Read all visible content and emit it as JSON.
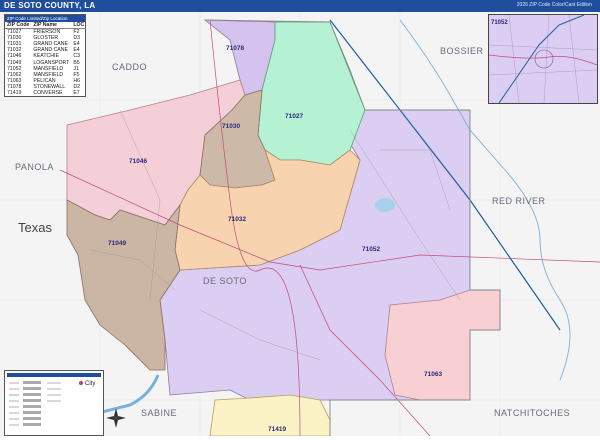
{
  "header": {
    "title": "DE SOTO COUNTY, LA",
    "edition": "2026 ZIP Code Color/Cast Edition"
  },
  "legend": {
    "header": "ZIP Code Limited/Zip Location",
    "columns": [
      "ZIP Code",
      "ZIP Name",
      "LOC"
    ],
    "rows": [
      [
        "71027",
        "FRIERSON",
        "F2"
      ],
      [
        "71030",
        "GLOSTER",
        "D3"
      ],
      [
        "71031",
        "GRAND CANE",
        "E4"
      ],
      [
        "71032",
        "GRAND CANE",
        "E4"
      ],
      [
        "71046",
        "KEATCHIE",
        "C3"
      ],
      [
        "71049",
        "LOGANSPORT",
        "B5"
      ],
      [
        "71052",
        "MANSFIELD",
        "J1"
      ],
      [
        "71062",
        "MANSFIELD",
        "F5"
      ],
      [
        "71063",
        "PELICAN",
        "H6"
      ],
      [
        "71078",
        "STONEWALL",
        "D2"
      ],
      [
        "71419",
        "CONVERSE",
        "E7"
      ]
    ]
  },
  "counties": {
    "caddo": "CADDO",
    "bossier": "BOSSIER",
    "panola": "PANOLA",
    "red_river": "RED RIVER",
    "de_soto": "DE SOTO",
    "natchitoches": "NATCHITOCHES",
    "sabine": "SABINE"
  },
  "state_label": "Texas",
  "zip_labels": {
    "z71078": "71078",
    "z71027": "71027",
    "z71030": "71030",
    "z71046": "71046",
    "z71032": "71032",
    "z71049": "71049",
    "z71052": "71052",
    "z71063": "71063",
    "z71419": "71419"
  },
  "inset": {
    "zip_label": "71052"
  },
  "bottom_legend": {
    "city_label": "City"
  },
  "colors": {
    "z71078": "#d5c2ee",
    "z71027": "#b5f2d3",
    "z71030": "#cdb9a8",
    "z71046": "#f5cfd8",
    "z71032": "#f7d3b0",
    "z71049": "#cbb5a5",
    "z71052": "#dccdf2",
    "z71062": "#d8c7f0",
    "z71063": "#f8cfd2",
    "z71419": "#fbf3c6",
    "header": "#1f4e9c"
  }
}
